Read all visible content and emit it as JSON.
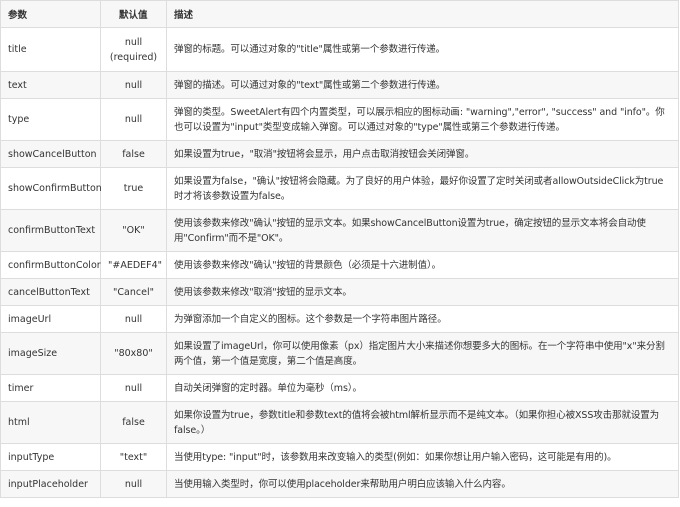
{
  "headers": {
    "param": "参数",
    "default": "默认值",
    "desc": "描述"
  },
  "rows": [
    {
      "name": "title",
      "default": "null\n(required)",
      "desc": "弹窗的标题。可以通过对象的\"title\"属性或第一个参数进行传递。"
    },
    {
      "name": "text",
      "default": "null",
      "desc": "弹窗的描述。可以通过对象的\"text\"属性或第二个参数进行传递。"
    },
    {
      "name": "type",
      "default": "null",
      "desc": "弹窗的类型。SweetAlert有四个内置类型，可以展示相应的图标动画: \"warning\",\"error\", \"success\" and \"info\"。你也可以设置为\"input\"类型变成输入弹窗。可以通过对象的\"type\"属性或第三个参数进行传递。"
    },
    {
      "name": "showCancelButton",
      "default": "false",
      "desc": "如果设置为true，\"取消\"按钮将会显示，用户点击取消按钮会关闭弹窗。"
    },
    {
      "name": "showConfirmButton",
      "default": "true",
      "desc": "如果设置为false，\"确认\"按钮将会隐藏。为了良好的用户体验，最好你设置了定时关闭或者allowOutsideClick为true时才将该参数设置为false。"
    },
    {
      "name": "confirmButtonText",
      "default": "\"OK\"",
      "desc": "使用该参数来修改\"确认\"按钮的显示文本。如果showCancelButton设置为true，确定按钮的显示文本将会自动使用\"Confirm\"而不是\"OK\"。"
    },
    {
      "name": "confirmButtonColor",
      "default": "\"#AEDEF4\"",
      "desc": "使用该参数来修改\"确认\"按钮的背景颜色（必须是十六进制值）。"
    },
    {
      "name": "cancelButtonText",
      "default": "\"Cancel\"",
      "desc": "使用该参数来修改\"取消\"按钮的显示文本。"
    },
    {
      "name": "imageUrl",
      "default": "null",
      "desc": "为弹窗添加一个自定义的图标。这个参数是一个字符串图片路径。"
    },
    {
      "name": "imageSize",
      "default": "\"80x80\"",
      "desc": "如果设置了imageUrl，你可以使用像素（px）指定图片大小来描述你想要多大的图标。在一个字符串中使用\"x\"来分割两个值，第一个值是宽度，第二个值是高度。"
    },
    {
      "name": "timer",
      "default": "null",
      "desc": "自动关闭弹窗的定时器。单位为毫秒（ms）。"
    },
    {
      "name": "html",
      "default": "false",
      "desc": "如果你设置为true，参数title和参数text的值将会被html解析显示而不是纯文本。（如果你担心被XSS攻击那就设置为false。）"
    },
    {
      "name": "inputType",
      "default": "\"text\"",
      "desc": "当使用type: \"input\"时，该参数用来改变输入的类型(例如：如果你想让用户输入密码，这可能是有用的)。"
    },
    {
      "name": "inputPlaceholder",
      "default": "null",
      "desc": "当使用输入类型时，你可以使用placeholder来帮助用户明白应该输入什么内容。"
    }
  ]
}
